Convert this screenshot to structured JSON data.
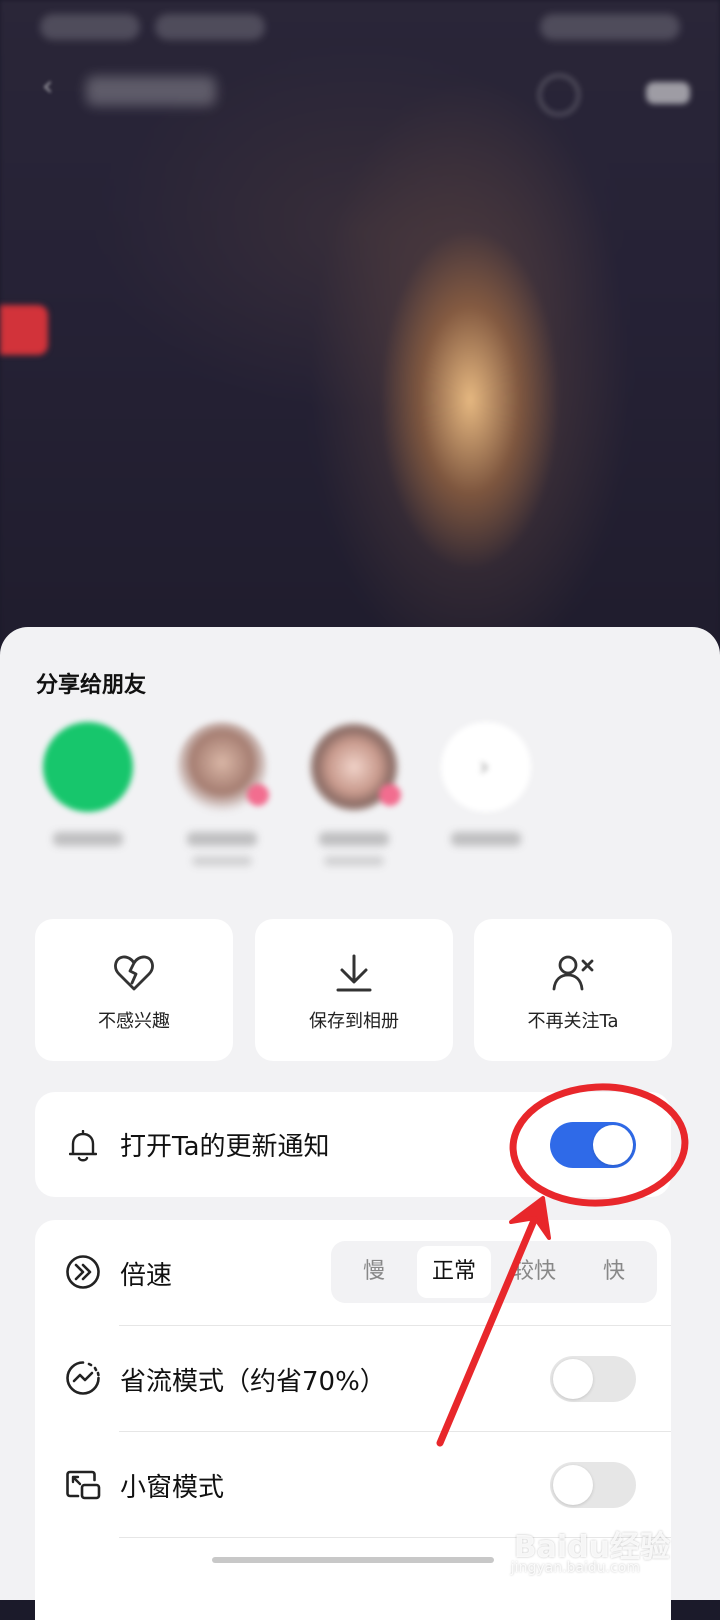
{
  "share": {
    "title": "分享给朋友",
    "friends": [
      {
        "avatar": "wechat-avatar"
      },
      {
        "avatar": "friend-avatar"
      },
      {
        "avatar": "friend-avatar"
      },
      {
        "avatar": "more-friends-icon"
      }
    ]
  },
  "actions": [
    {
      "label": "不感兴趣",
      "icon": "broken-heart-icon"
    },
    {
      "label": "保存到相册",
      "icon": "download-icon"
    },
    {
      "label": "不再关注Ta",
      "icon": "unfollow-user-icon"
    }
  ],
  "notify": {
    "label": "打开Ta的更新通知",
    "icon": "bell-icon",
    "enabled": true
  },
  "settings": {
    "speed": {
      "label": "倍速",
      "icon": "speed-icon",
      "options": [
        "慢",
        "正常",
        "较快",
        "快"
      ],
      "selected": "正常"
    },
    "data_saver": {
      "label": "省流模式（约省70%）",
      "icon": "data-saver-icon",
      "enabled": false
    },
    "mini_window": {
      "label": "小窗模式",
      "icon": "mini-window-icon",
      "enabled": false
    }
  },
  "colors": {
    "accent": "#2f6ae8",
    "annotation": "#e8272b",
    "sheet_bg": "#f2f2f4"
  },
  "watermark": {
    "text": "Baidu经验",
    "sub": "jingyan.baidu.com"
  }
}
